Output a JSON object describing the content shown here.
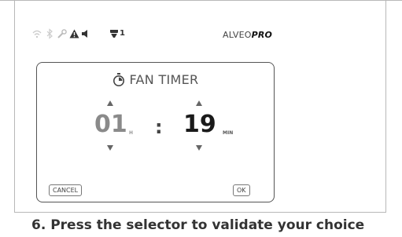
{
  "status_bar": {
    "icons": [
      "wifi-icon",
      "bluetooth-icon",
      "wrench-icon",
      "warning-icon",
      "speaker-icon",
      "fan-icon"
    ],
    "fan_speed": "1"
  },
  "brand": {
    "prefix": "ALVEO",
    "suffix": "PRO"
  },
  "dialog": {
    "icon": "stopwatch-icon",
    "title": "FAN TIMER",
    "hours": "01",
    "hours_unit": "H",
    "separator": ":",
    "minutes": "19",
    "minutes_unit": "MIN",
    "cancel_label": "CANCEL",
    "ok_label": "OK"
  },
  "caption": "6. Press the selector to validate your choice",
  "colors": {
    "frame": "#555555",
    "hours_text": "#8a8a8a",
    "minutes_text": "#1a1a1a"
  }
}
